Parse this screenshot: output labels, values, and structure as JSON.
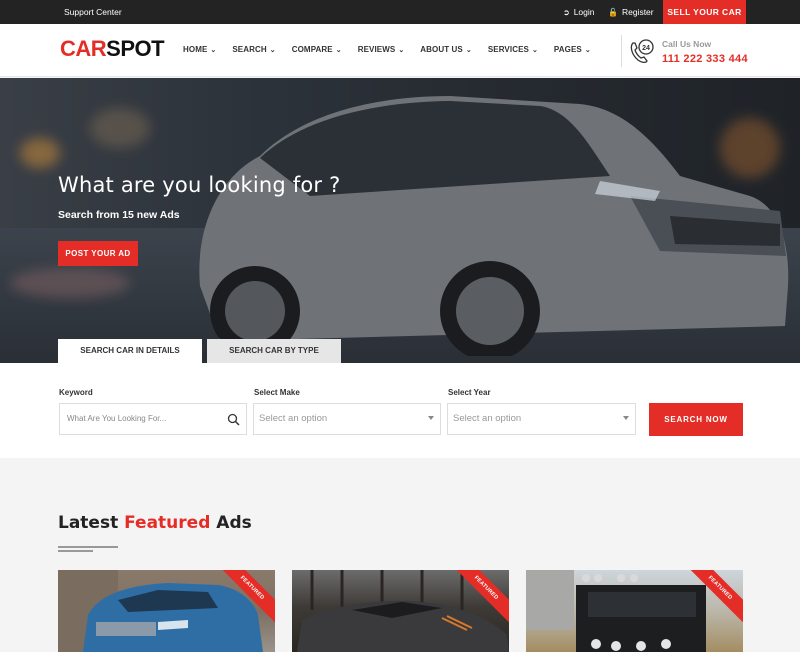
{
  "topbar": {
    "support_label": "Support Center",
    "login_label": "Login",
    "register_label": "Register",
    "sell_label": "SELL YOUR CAR"
  },
  "header": {
    "logo_part1": "CAR",
    "logo_part2": "SPOT",
    "nav": [
      {
        "label": "HOME"
      },
      {
        "label": "SEARCH"
      },
      {
        "label": "COMPARE"
      },
      {
        "label": "REVIEWS"
      },
      {
        "label": "ABOUT US"
      },
      {
        "label": "SERVICES"
      },
      {
        "label": "PAGES"
      }
    ],
    "call_label": "Call Us Now",
    "call_number": "111 222 333 444",
    "phone_badge": "24"
  },
  "hero": {
    "title": "What are you looking for ?",
    "subtitle": "Search from 15 new Ads",
    "post_ad_label": "POST YOUR AD",
    "tabs": [
      {
        "label": "SEARCH CAR IN DETAILS",
        "active": true
      },
      {
        "label": "SEARCH CAR BY TYPE",
        "active": false
      }
    ]
  },
  "search": {
    "keyword_label": "Keyword",
    "keyword_placeholder": "What Are You Looking For...",
    "make_label": "Select Make",
    "make_value": "Select an option",
    "year_label": "Select Year",
    "year_value": "Select an option",
    "button_label": "SEARCH NOW"
  },
  "featured": {
    "title_part1": "Latest ",
    "title_part2": "Featured",
    "title_part3": " Ads",
    "badge": "FEATURED",
    "cards": [
      {
        "image": "blue-suv"
      },
      {
        "image": "black-sports-car"
      },
      {
        "image": "black-hummer"
      }
    ]
  },
  "colors": {
    "accent": "#e52d27",
    "topbar": "#232323"
  }
}
